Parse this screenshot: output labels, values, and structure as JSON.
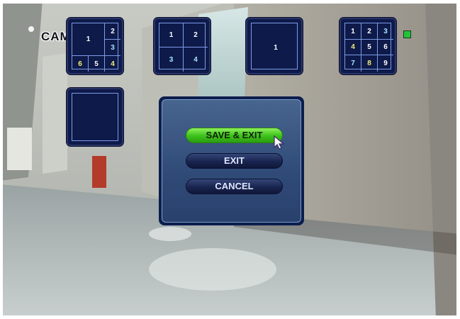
{
  "overlay": {
    "camera_label": "CAM",
    "status_color": "#22c23a"
  },
  "layouts": [
    {
      "name": "layout-6-split",
      "cells": [
        "1",
        "2",
        "3",
        "6",
        "5",
        "4"
      ]
    },
    {
      "name": "layout-4-split",
      "cells": [
        "1",
        "2",
        "3",
        "4"
      ]
    },
    {
      "name": "layout-single",
      "cells": [
        "1"
      ]
    },
    {
      "name": "layout-9-split",
      "cells": [
        "1",
        "2",
        "3",
        "4",
        "5",
        "6",
        "7",
        "8",
        "9"
      ]
    },
    {
      "name": "layout-empty",
      "cells": []
    }
  ],
  "dialog": {
    "buttons": [
      {
        "label": "SAVE & EXIT",
        "highlighted": true
      },
      {
        "label": "EXIT",
        "highlighted": false
      },
      {
        "label": "CANCEL",
        "highlighted": false
      }
    ]
  },
  "colors": {
    "panel_bg": "#0e1a4a",
    "panel_border": "#7f9be6",
    "highlight": "#3fc41c"
  }
}
